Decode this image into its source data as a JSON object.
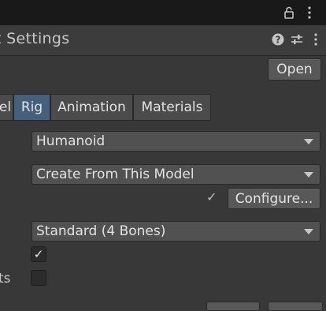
{
  "toolbar": {
    "lock_icon": "lock-icon",
    "menu_icon": "kebab-menu-icon"
  },
  "inspector": {
    "title": "t Settings",
    "help_icon": "help-icon",
    "presets_icon": "presets-icon",
    "menu_icon": "kebab-menu-icon",
    "open_button": "Open"
  },
  "tabs": [
    {
      "label": "el",
      "active": false
    },
    {
      "label": "Rig",
      "active": true
    },
    {
      "label": "Animation",
      "active": false
    },
    {
      "label": "Materials",
      "active": false
    }
  ],
  "rig": {
    "animation_type": "Humanoid",
    "avatar_definition": "Create From This Model",
    "configure_check": "✓",
    "configure_button": "Configure...",
    "skin_weights": "Standard (4 Bones)",
    "checkbox_1_checked": true,
    "checkbox_1_mark": "✓",
    "checkbox_2_label": "ts",
    "checkbox_2_checked": false
  },
  "colors": {
    "background": "#383838",
    "active_tab": "#46607c",
    "button": "#585858"
  }
}
